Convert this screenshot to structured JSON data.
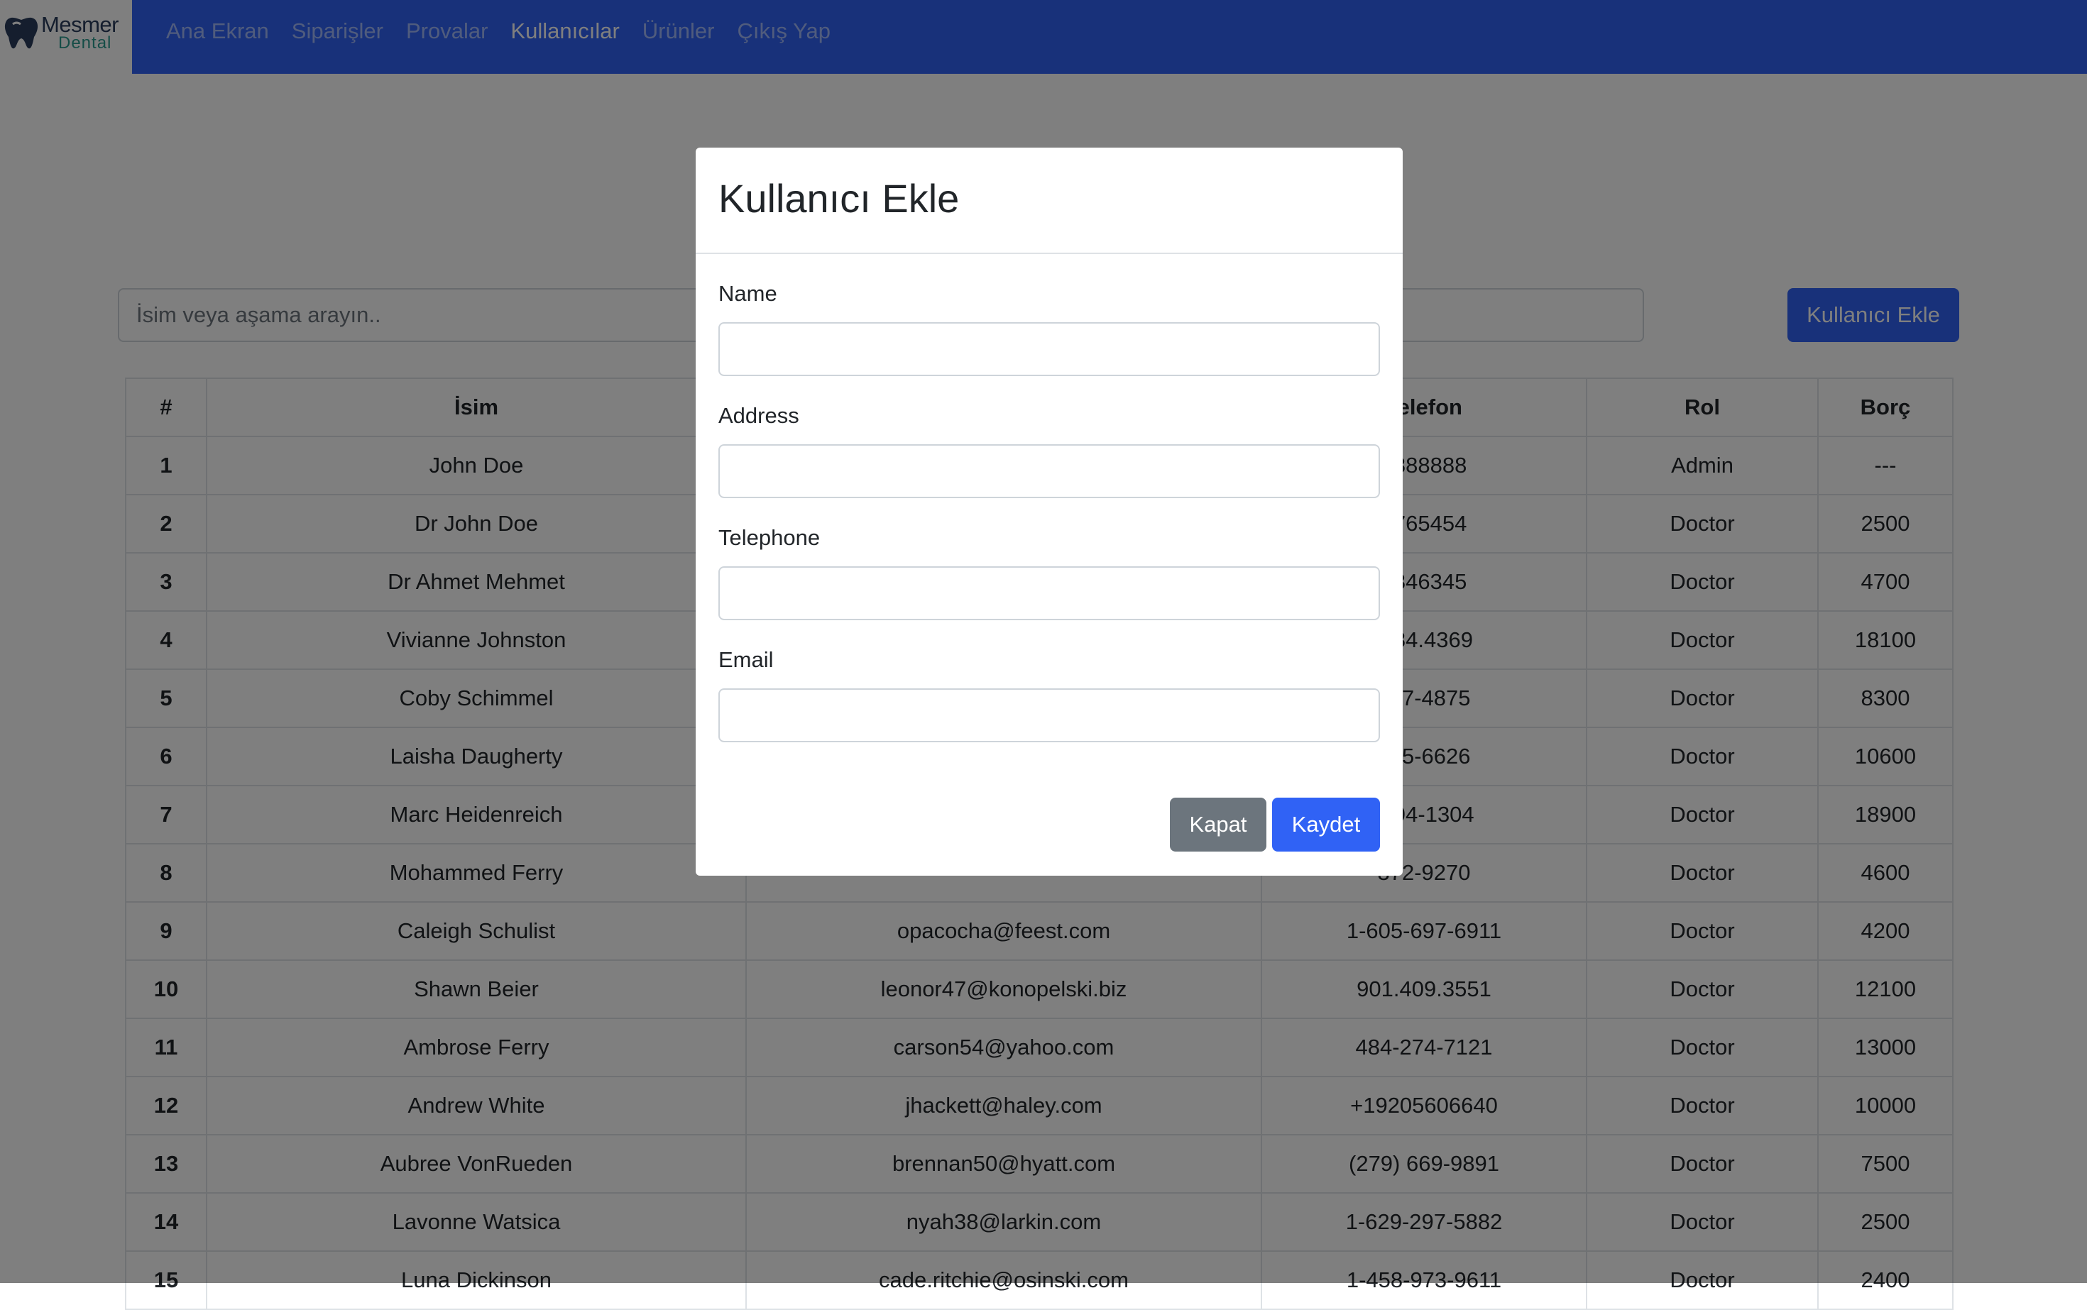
{
  "brand": {
    "name": "Mesmer",
    "sub": "Dental"
  },
  "nav": {
    "links": [
      {
        "label": "Ana Ekran"
      },
      {
        "label": "Siparişler"
      },
      {
        "label": "Provalar"
      },
      {
        "label": "Kullanıcılar",
        "active": true
      },
      {
        "label": "Ürünler"
      },
      {
        "label": "Çıkış Yap"
      }
    ]
  },
  "search": {
    "placeholder": "İsim veya aşama arayın..",
    "value": ""
  },
  "add_button": "Kullanıcı Ekle",
  "table": {
    "headers": [
      "#",
      "İsim",
      "",
      "Telefon",
      "Rol",
      "Borç"
    ],
    "rows": [
      [
        "1",
        "John Doe",
        "",
        "8888888",
        "Admin",
        "---"
      ],
      [
        "2",
        "Dr John Doe",
        "",
        "8765454",
        "Doctor",
        "2500"
      ],
      [
        "3",
        "Dr Ahmet Mehmet",
        "",
        "6346345",
        "Doctor",
        "4700"
      ],
      [
        "4",
        "Vivianne Johnston",
        "",
        ".784.4369",
        "Doctor",
        "18100"
      ],
      [
        "5",
        "Coby Schimmel",
        "",
        "577-4875",
        "Doctor",
        "8300"
      ],
      [
        "6",
        "Laisha Daugherty",
        "",
        "965-6626",
        "Doctor",
        "10600"
      ],
      [
        "7",
        "Marc Heidenreich",
        "",
        "-694-1304",
        "Doctor",
        "18900"
      ],
      [
        "8",
        "Mohammed Ferry",
        "",
        "372-9270",
        "Doctor",
        "4600"
      ],
      [
        "9",
        "Caleigh Schulist",
        "opacocha@feest.com",
        "1-605-697-6911",
        "Doctor",
        "4200"
      ],
      [
        "10",
        "Shawn Beier",
        "leonor47@konopelski.biz",
        "901.409.3551",
        "Doctor",
        "12100"
      ],
      [
        "11",
        "Ambrose Ferry",
        "carson54@yahoo.com",
        "484-274-7121",
        "Doctor",
        "13000"
      ],
      [
        "12",
        "Andrew White",
        "jhackett@haley.com",
        "+19205606640",
        "Doctor",
        "10000"
      ],
      [
        "13",
        "Aubree VonRueden",
        "brennan50@hyatt.com",
        "(279) 669-9891",
        "Doctor",
        "7500"
      ],
      [
        "14",
        "Lavonne Watsica",
        "nyah38@larkin.com",
        "1-629-297-5882",
        "Doctor",
        "2500"
      ],
      [
        "15",
        "Luna Dickinson",
        "cade.ritchie@osinski.com",
        "1-458-973-9611",
        "Doctor",
        "2400"
      ]
    ]
  },
  "modal": {
    "title": "Kullanıcı Ekle",
    "fields": [
      {
        "label": "Name",
        "value": ""
      },
      {
        "label": "Address",
        "value": ""
      },
      {
        "label": "Telephone",
        "value": ""
      },
      {
        "label": "Email",
        "value": ""
      }
    ],
    "close_label": "Kapat",
    "save_label": "Kaydet"
  }
}
